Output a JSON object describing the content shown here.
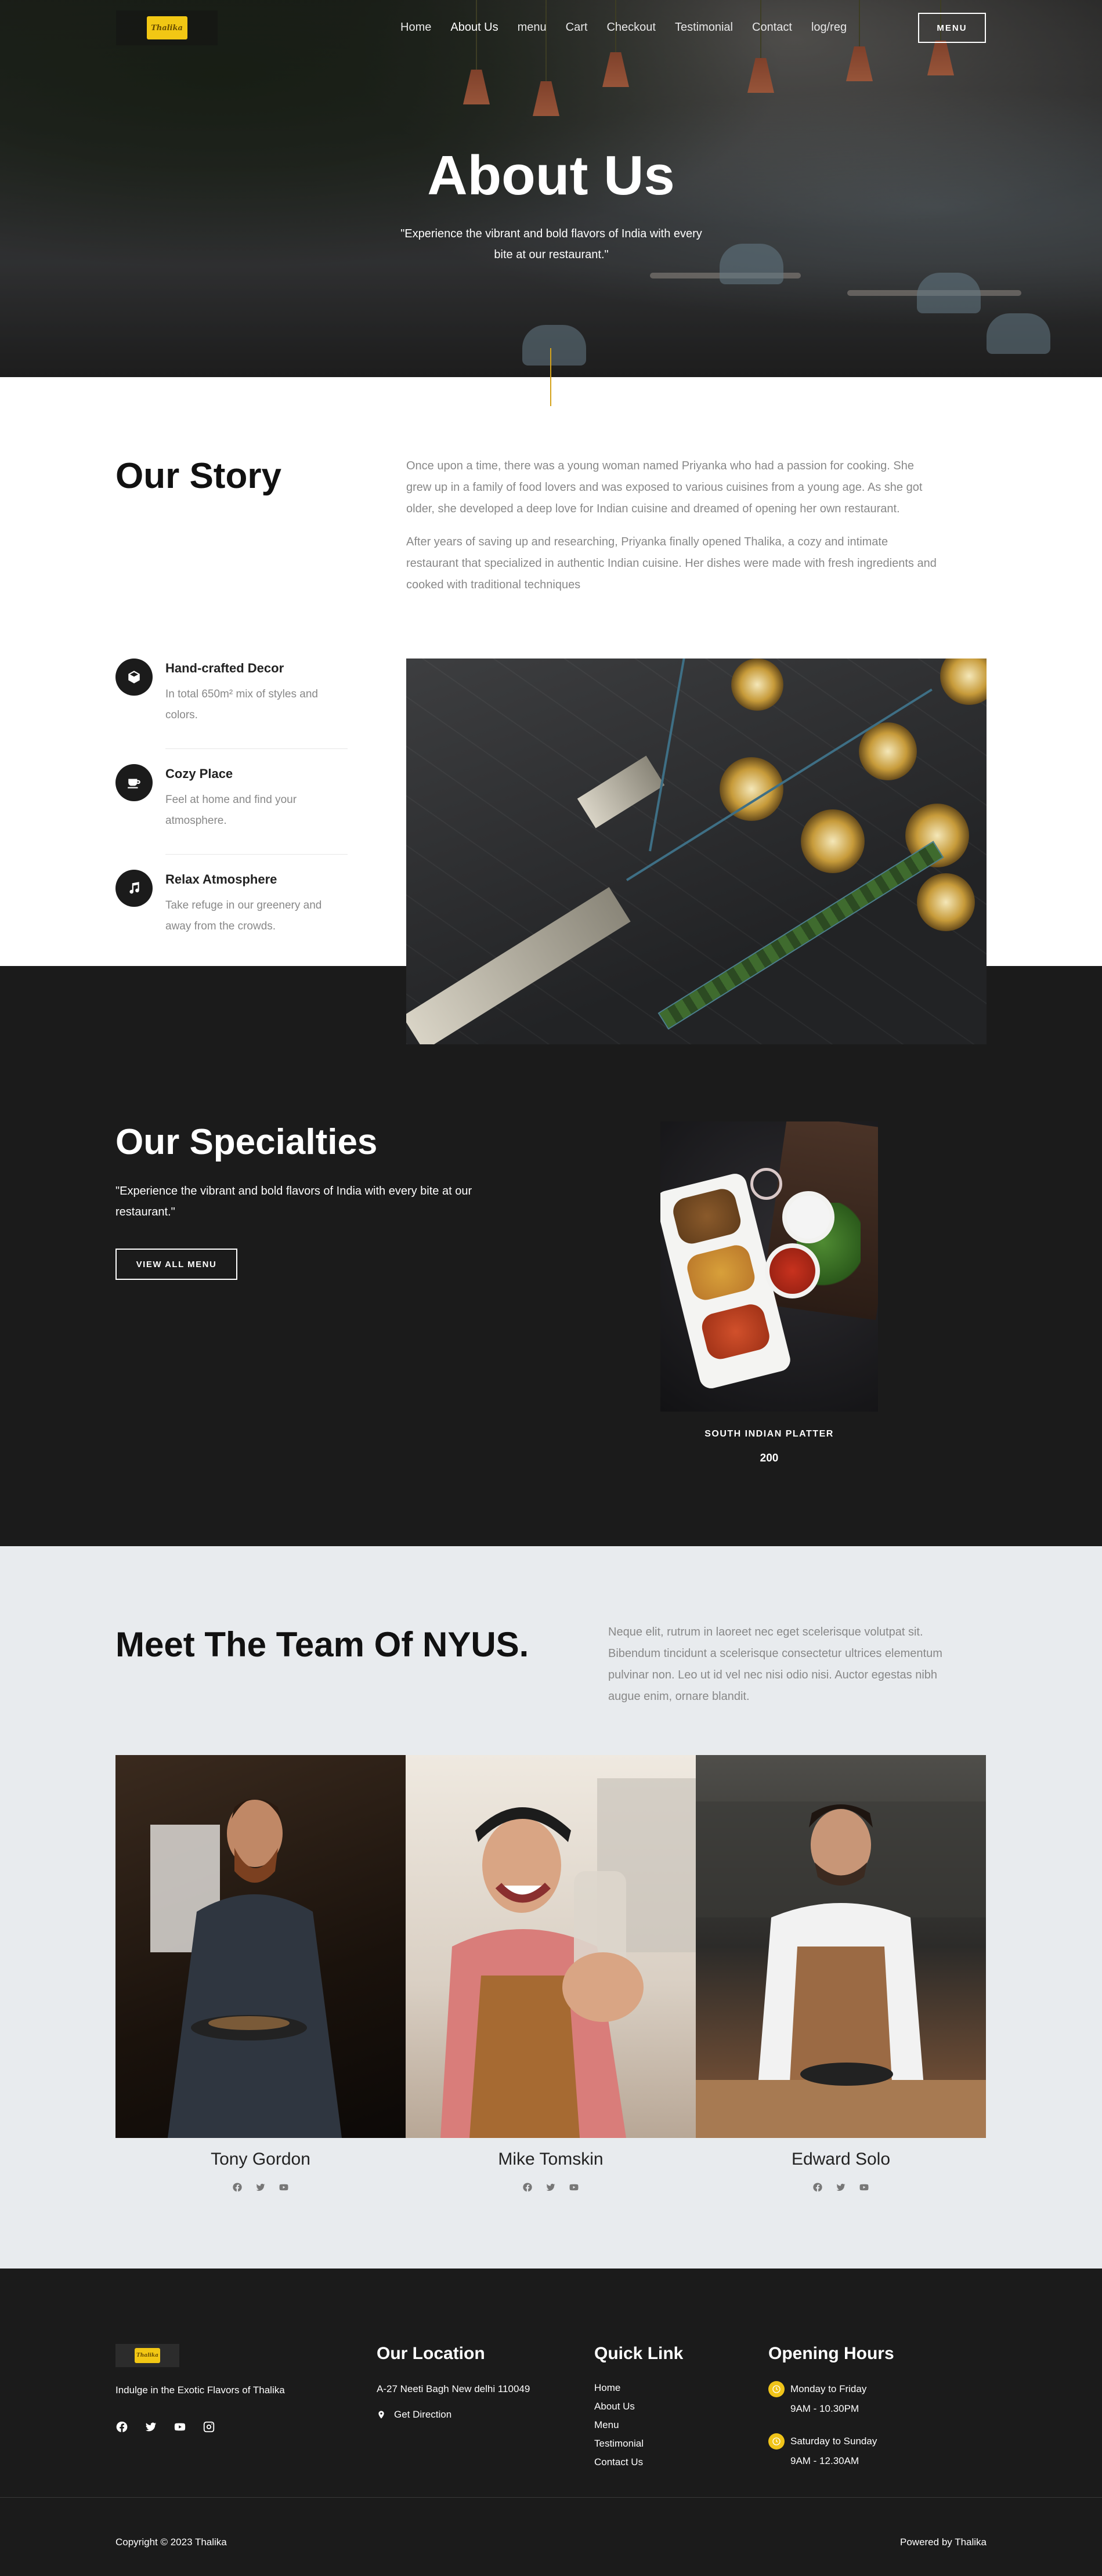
{
  "brand": {
    "logo_text": "Thalika"
  },
  "nav": {
    "links": [
      "Home",
      "About Us",
      "menu",
      "Cart",
      "Checkout",
      "Testimonial",
      "Contact",
      "log/reg"
    ],
    "active": "About Us",
    "menu_button": "MENU"
  },
  "hero": {
    "title": "About Us",
    "subtitle": "\"Experience the vibrant and bold flavors of India with every bite at our restaurant.\""
  },
  "story": {
    "title": "Our Story",
    "paragraphs": [
      "Once upon a time, there was a young woman named Priyanka who had a passion for cooking. She grew up in a family of food lovers and was exposed to various cuisines from a young age. As she got older, she developed a deep love for Indian cuisine and dreamed of opening her own restaurant.",
      "After years of saving up and researching, Priyanka finally opened Thalika, a cozy and intimate restaurant that specialized in authentic Indian cuisine. Her dishes were made with fresh ingredients and cooked with traditional techniques"
    ],
    "features": [
      {
        "icon": "cube-icon",
        "title": "Hand-crafted Decor",
        "desc": "In total 650m² mix of styles and colors."
      },
      {
        "icon": "coffee-cup-icon",
        "title": "Cozy Place",
        "desc": "Feel at home and find your atmosphere."
      },
      {
        "icon": "music-note-icon",
        "title": "Relax Atmosphere",
        "desc": "Take refuge in our greenery and away from the crowds."
      }
    ]
  },
  "specialties": {
    "title": "Our Specialties",
    "quote": "\"Experience the vibrant and bold flavors of India with every bite at our restaurant.\"",
    "button": "VIEW ALL MENU",
    "dish": {
      "name": "SOUTH INDIAN PLATTER",
      "price": "200"
    }
  },
  "team": {
    "title": "Meet The Team Of NYUS.",
    "text": "Neque elit, rutrum in laoreet nec eget scelerisque volutpat sit. Bibendum tincidunt a scelerisque consectetur ultrices elementum pulvinar non. Leo ut id vel nec nisi odio nisi. Auctor egestas nibh augue enim, ornare blandit.",
    "members": [
      {
        "name": "Tony Gordon"
      },
      {
        "name": "Mike Tomskin"
      },
      {
        "name": "Edward Solo"
      }
    ],
    "socials": [
      "facebook-icon",
      "twitter-icon",
      "youtube-icon"
    ]
  },
  "footer": {
    "tagline": "Indulge in the Exotic Flavors of Thalika",
    "socials": [
      "facebook-icon",
      "twitter-icon",
      "youtube-icon",
      "instagram-icon"
    ],
    "location": {
      "title": "Our Location",
      "address": "A-27 Neeti Bagh New delhi 110049",
      "direction": "Get Direction"
    },
    "quick_link": {
      "title": "Quick Link",
      "links": [
        "Home",
        "About Us",
        "Menu",
        "Testimonial",
        "Contact Us"
      ]
    },
    "hours": {
      "title": "Opening Hours",
      "rows": [
        {
          "days": "Monday to Friday",
          "time": "9AM - 10.30PM"
        },
        {
          "days": "Saturday to Sunday",
          "time": "9AM - 12.30AM"
        }
      ]
    },
    "copyright": "Copyright © 2023 Thalika",
    "powered": "Powered by Thalika"
  },
  "colors": {
    "accent": "#f0c419",
    "dark": "#1b1b1b",
    "light_section": "#e8ebee",
    "muted_text": "#888888"
  }
}
